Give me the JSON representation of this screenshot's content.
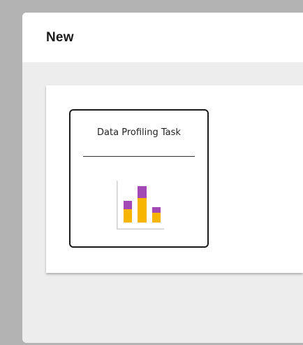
{
  "dialog": {
    "title": "New"
  },
  "tasks": [
    {
      "label": "Data Profiling Task",
      "icon": "bar-chart-icon"
    }
  ],
  "colors": {
    "bar_top": "#a349b5",
    "bar_bottom": "#f7b500",
    "axis": "#cfcfcf"
  }
}
